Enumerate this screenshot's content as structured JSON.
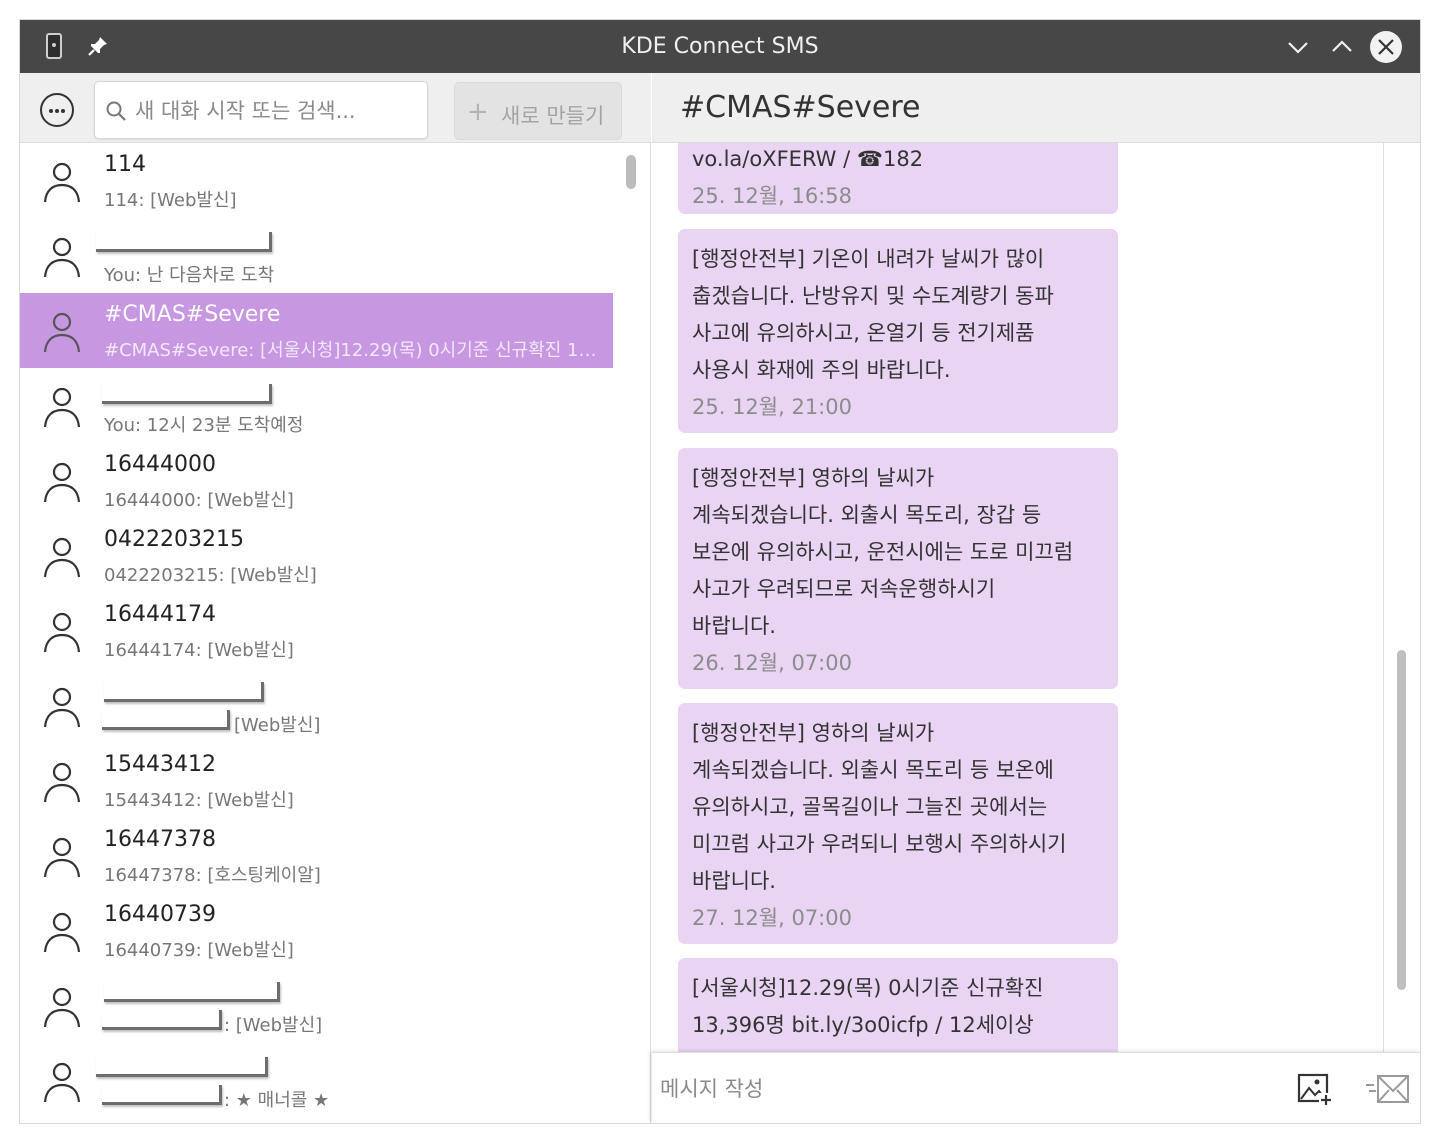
{
  "window": {
    "title": "KDE Connect SMS"
  },
  "search": {
    "placeholder": "새 대화 시작 또는 검색..."
  },
  "toolbar": {
    "new_label": "새로 만들기"
  },
  "conversations": [
    {
      "name": "114",
      "preview": "114: [Web발신]"
    },
    {
      "name": "",
      "preview": "You: 난 다음차로 도착",
      "name_redacted": true
    },
    {
      "name": "#CMAS#Severe",
      "preview": "#CMAS#Severe: [서울시청]12.29(목) 0시기준 신규확진 13...",
      "selected": true
    },
    {
      "name": "",
      "preview": "You: 12시 23분 도착예정",
      "name_redacted": true
    },
    {
      "name": "16444000",
      "preview": "16444000: [Web발신]"
    },
    {
      "name": "0422203215",
      "preview": "0422203215: [Web발신]"
    },
    {
      "name": "16444174",
      "preview": "16444174: [Web발신]"
    },
    {
      "name": "",
      "preview": "[Web발신]",
      "name_redacted": true,
      "preview_redacted": true
    },
    {
      "name": "15443412",
      "preview": "15443412: [Web발신]"
    },
    {
      "name": "16447378",
      "preview": "16447378: [호스팅케이알]"
    },
    {
      "name": "16440739",
      "preview": "16440739: [Web발신]"
    },
    {
      "name": "",
      "preview": ": [Web발신]",
      "name_redacted": true,
      "preview_redacted": true
    },
    {
      "name": "",
      "preview": ": ★ 매너콜 ★",
      "name_redacted": true,
      "preview_redacted": true
    }
  ],
  "conversation": {
    "title": "#CMAS#Severe",
    "messages": [
      {
        "text": "vo.la/oXFERW / ☎182",
        "time": "25. 12월, 16:58"
      },
      {
        "text": "[행정안전부] 기온이 내려가 날씨가 많이\n춥겠습니다. 난방유지 및 수도계량기 동파\n사고에 유의하시고, 온열기 등 전기제품\n사용시 화재에 주의 바랍니다.",
        "time": "25. 12월, 21:00"
      },
      {
        "text": "[행정안전부] 영하의 날씨가\n계속되겠습니다. 외출시 목도리, 장갑 등\n보온에 유의하시고, 운전시에는 도로 미끄럼\n사고가 우려되므로 저속운행하시기\n바랍니다.",
        "time": "26. 12월, 07:00"
      },
      {
        "text": "[행정안전부] 영하의 날씨가\n계속되겠습니다. 외출시 목도리 등 보온에\n유의하시고, 골목길이나 그늘진 곳에서는\n미끄럼 사고가 우려되니 보행시 주의하시기\n바랍니다.",
        "time": "27. 12월, 07:00"
      },
      {
        "text": "[서울시청]12.29(목) 0시기준 신규확진\n13,396명 bit.ly/3o0icfp / 12세이상",
        "time": ""
      }
    ]
  },
  "compose": {
    "placeholder": "메시지 작성"
  },
  "icons": {
    "menu": "ellipsis-circle-icon",
    "search": "search-icon",
    "new": "plus-icon",
    "avatar": "person-icon",
    "attach": "add-image-icon",
    "send": "send-icon",
    "minimize": "chevron-down-icon",
    "maximize": "chevron-up-icon",
    "close": "close-icon",
    "pin": "pin-icon",
    "app": "kde-connect-icon"
  },
  "colors": {
    "titlebar": "#474747",
    "selection": "#c797e2",
    "bubble": "#e9d4f3"
  }
}
